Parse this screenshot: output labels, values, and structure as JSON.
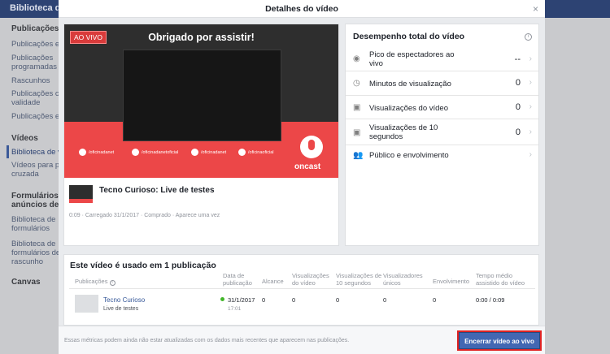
{
  "background": {
    "title": "Biblioteca de",
    "sidebar": [
      {
        "type": "section",
        "label": "Publicações"
      },
      {
        "type": "item",
        "label": "Publicações er"
      },
      {
        "type": "item",
        "label": "Publicações\nprogramadas"
      },
      {
        "type": "item",
        "label": "Rascunhos"
      },
      {
        "type": "item",
        "label": "Publicações co\nvalidade"
      },
      {
        "type": "item",
        "label": "Publicações ex"
      },
      {
        "type": "section",
        "label": "Vídeos"
      },
      {
        "type": "item",
        "label": "Biblioteca de v",
        "active": true
      },
      {
        "type": "item",
        "label": "Vídeos para po\ncruzada"
      },
      {
        "type": "section",
        "label": "Formulários c\nanúncios de"
      },
      {
        "type": "item",
        "label": "Biblioteca de\nformulários"
      },
      {
        "type": "item",
        "label": "Biblioteca de\nformulários de\nrascunho"
      },
      {
        "type": "section",
        "label": "Canvas"
      }
    ]
  },
  "modal": {
    "title": "Detalhes do vídeo",
    "close_icon": "×"
  },
  "video": {
    "live_badge": "AO VIVO",
    "overlay_title": "Obrigado por assistir!",
    "social": [
      {
        "icon": "facebook-icon",
        "handle": "/oficinadanet"
      },
      {
        "icon": "instagram-icon",
        "handle": "/oficinadanetoficial"
      },
      {
        "icon": "twitter-icon",
        "handle": "/oficinadanet"
      },
      {
        "icon": "snapchat-icon",
        "handle": "/oficinaoficial"
      }
    ],
    "brand": "oncast",
    "name": "Tecno Curioso: Live de testes",
    "meta": "0:09 · Carregado 31/1/2017 · Comprado · Aparece uma vez"
  },
  "performance": {
    "title": "Desempenho total do vídeo",
    "metrics": [
      {
        "icon": "eye-icon",
        "label": "Pico de espectadores ao vivo",
        "value": "--"
      },
      {
        "icon": "clock-icon",
        "label": "Minutos de visualização",
        "value": "0"
      },
      {
        "icon": "video-views-icon",
        "label": "Visualizações do vídeo",
        "value": "0"
      },
      {
        "icon": "video-views-icon",
        "label": "Visualizações de 10 segundos",
        "value": "0"
      },
      {
        "icon": "people-icon",
        "label": "Público e envolvimento",
        "value": ""
      }
    ]
  },
  "usage": {
    "title": "Este vídeo é usado em 1 publicação",
    "headers": {
      "publicacoes": "Publicações",
      "data": "Data de publicação",
      "alcance": "Alcance",
      "visualizacoes": "Visualizações do vídeo",
      "visualizacoes10": "Visualizações de 10 segundos",
      "visualizadores": "Visualizadores únicos",
      "envolvimento": "Envolvimento",
      "tempo": "Tempo médio assistido do vídeo"
    },
    "row": {
      "page": "Tecno Curioso",
      "type": "Live de testes",
      "date": "31/1/2017",
      "time": "17:01",
      "alcance": "0",
      "visualizacoes": "0",
      "visualizacoes10": "0",
      "visualizadores": "0",
      "envolvimento": "0",
      "tempo": "0:00 / 0:09"
    }
  },
  "footer": {
    "note": "Essas métricas podem ainda não estar atualizadas com os dados mais recentes que aparecem nas publicações.",
    "end_button": "Encerrar vídeo ao vivo"
  },
  "colors": {
    "brand_blue": "#4267b2",
    "live_red": "#ec4748",
    "status_green": "#42b72a"
  }
}
